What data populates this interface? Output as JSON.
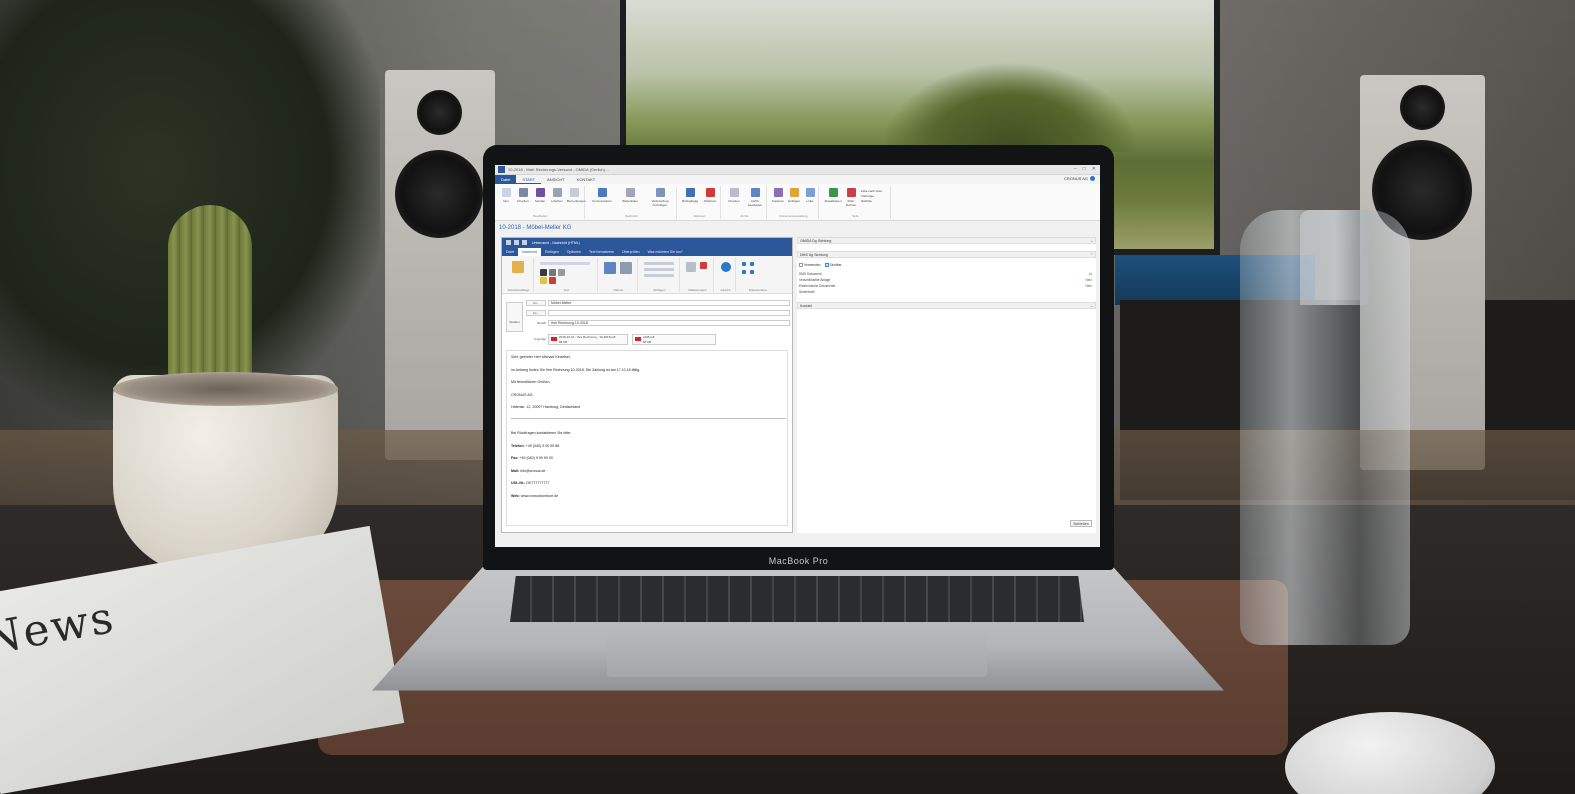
{
  "scene": {
    "newspaper_title": "News",
    "laptop_brand": "MacBook Pro"
  },
  "app": {
    "title": "10-2018 - Mail: Rechnungs-Versand - OMIDA (Gerlich) ...",
    "tabs": [
      {
        "label": "Datei"
      },
      {
        "label": "START"
      },
      {
        "label": "ANSICHT"
      },
      {
        "label": "KONTAKT"
      }
    ],
    "user": "CRONUS AG",
    "ribbon_groups": [
      {
        "caption": "Bearbeiten",
        "buttons": [
          {
            "label": "Neu"
          },
          {
            "label": "Drucken"
          },
          {
            "label": "Senden"
          },
          {
            "label": "Löschen"
          },
          {
            "label": "Bemerkungen"
          }
        ]
      },
      {
        "caption": "Nachricht",
        "buttons": [
          {
            "label": "Kommentieren"
          },
          {
            "label": "Weiterleiten"
          },
          {
            "label": "Verknüpfung hinzufügen"
          }
        ]
      },
      {
        "caption": "Aktionen",
        "buttons": [
          {
            "label": "Rückgängig"
          },
          {
            "label": "Ablehnen"
          }
        ]
      },
      {
        "caption": "Archiv",
        "buttons": [
          {
            "label": "Drucken"
          },
          {
            "label": "Archiv bearbeiten"
          }
        ]
      },
      {
        "caption": "Dokumentverwaltung",
        "buttons": [
          {
            "label": "Kopieren"
          },
          {
            "label": "Einfügen"
          },
          {
            "label": "Links"
          }
        ]
      },
      {
        "caption": "Seite",
        "buttons": [
          {
            "label": "Aktualisieren"
          },
          {
            "label": "Filter löschen"
          },
          {
            "label": "Zeile nach oben"
          },
          {
            "label": "Vorherige"
          },
          {
            "label": "Nächste"
          }
        ]
      }
    ],
    "doc_title": "10-2018 - Möbel-Meller KG"
  },
  "mail": {
    "title": "Unbenannt - Nachricht (HTML)",
    "tabs": [
      {
        "label": "Datei"
      },
      {
        "label": "Nachricht"
      },
      {
        "label": "Einfügen"
      },
      {
        "label": "Optionen"
      },
      {
        "label": "Text formatieren"
      },
      {
        "label": "Überprüfen"
      },
      {
        "label": "Was möchten Sie tun?"
      }
    ],
    "ribbon_groups": [
      {
        "caption": "Zwischenablage"
      },
      {
        "caption": "Text"
      },
      {
        "caption": "Namen"
      },
      {
        "caption": "Einfügen"
      },
      {
        "caption": "Markierungen"
      },
      {
        "caption": "Add-Ins"
      },
      {
        "caption": "Dokumentbox"
      }
    ],
    "send_label": "Senden",
    "to_label": "An...",
    "cc_label": "Cc...",
    "subject_label": "Betreff",
    "attach_label": "Angefügt",
    "to_value": "Möbel-Meller",
    "cc_value": "",
    "subject_value": "Ihre Rechnung 10-2018",
    "attachments": [
      {
        "name": "2018-10-01 - Ihre Rechnung - 10-2018.pdf",
        "size": "86 KB"
      },
      {
        "name": "AGB.pdf",
        "size": "55 KB"
      }
    ],
    "body": {
      "greeting": "Sehr geehrter Herr Michael Kinselsel,",
      "line1": "im Anhang finden Sie Ihre Rechnung 10-2018. Die Zahlung ist am 17.10.18 fällig.",
      "closing": "Mit freundlichen Grüßen,",
      "company": "CRONUS AG",
      "address": "Hafenstr. 12, 20097 Hamburg, Deutschland",
      "contact_intro": "Bei Rückfragen kontaktieren Sie bitte:",
      "phone_label": "Telefon:",
      "phone": "+49 (040) 9 00 99 88",
      "fax_label": "Fax:",
      "fax": "+49 (040) 9 99 99 00",
      "mail_label": "Mail:",
      "mail": "info@cronus.de",
      "ust_label": "USt.-Nr.:",
      "ust": "DE777777777",
      "web_label": "Web:",
      "web": "www.cronusfurniture.de"
    }
  },
  "side": {
    "panel1": "OMIDA Dg Sichtung",
    "panel2": "DMS Dg Sichtung",
    "check1": "Verwenden",
    "check2": "Sichtbar",
    "rows": [
      {
        "label": "DMS Dokument",
        "value": "Ja"
      },
      {
        "label": "Verschlüsselte Ablage",
        "value": "Nein"
      },
      {
        "label": "Elektronische Dokumente",
        "value": "Nein"
      },
      {
        "label": "Serienbrief",
        "value": ""
      }
    ],
    "panel3": "Kontakt",
    "close_label": "Schließen"
  }
}
